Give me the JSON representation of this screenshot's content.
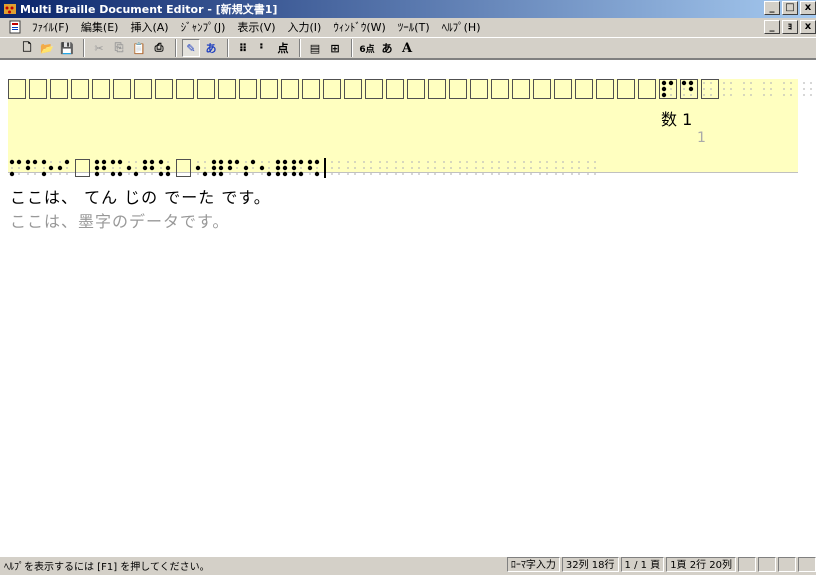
{
  "window": {
    "title": "Multi Braille Document Editor - [新規文書1]",
    "controls": [
      "_",
      "□",
      "x"
    ]
  },
  "menu": {
    "items": [
      "ﾌｧｲﾙ(F)",
      "編集(E)",
      "挿入(A)",
      "ｼﾞｬﾝﾌﾟ(J)",
      "表示(V)",
      "入力(I)",
      "ｳｨﾝﾄﾞｳ(W)",
      "ﾂｰﾙ(T)",
      "ﾍﾙﾌﾟ(H)"
    ],
    "mdi_controls": [
      "_",
      "ｮ",
      "x"
    ]
  },
  "toolbar": {
    "buttons": [
      {
        "name": "new-button",
        "icon": "new-document-icon",
        "glyph": "🗋"
      },
      {
        "name": "open-button",
        "icon": "open-folder-icon",
        "glyph": "📂"
      },
      {
        "name": "save-button",
        "icon": "save-icon",
        "glyph": "💾"
      },
      {
        "name": "cut-button",
        "icon": "cut-icon",
        "glyph": "✂"
      },
      {
        "name": "copy-button",
        "icon": "copy-icon",
        "glyph": "⎘"
      },
      {
        "name": "paste-button",
        "icon": "paste-icon",
        "glyph": "📋"
      },
      {
        "name": "print-button",
        "icon": "print-icon",
        "glyph": "⎙"
      },
      {
        "name": "braille-edit-button",
        "icon": "braille-edit-icon",
        "glyph": "✎"
      },
      {
        "name": "kana-edit-button",
        "icon": "kana-edit-icon",
        "glyph": "あ"
      },
      {
        "name": "braille-grid-button",
        "icon": "braille-grid-icon",
        "glyph": "⠿"
      },
      {
        "name": "braille-translate-button",
        "icon": "braille-translate-icon",
        "glyph": "⠃"
      },
      {
        "name": "kana-translate-button",
        "icon": "kana-translate-icon",
        "glyph": "点"
      },
      {
        "name": "layout-button",
        "icon": "layout-icon",
        "glyph": "▤"
      },
      {
        "name": "table-button",
        "icon": "table-icon",
        "glyph": "⊞"
      },
      {
        "name": "six-dot-button",
        "icon": "six-dot-icon",
        "glyph": "6点"
      },
      {
        "name": "hiragana-button",
        "icon": "hiragana-icon",
        "glyph": "あ"
      },
      {
        "name": "alphabet-button",
        "icon": "alphabet-icon",
        "glyph": "A"
      }
    ]
  },
  "document": {
    "number_label": "数 1",
    "number_value": "1",
    "text_line": "ここは、 てん じの でーた です。",
    "ink_line": "ここは、墨字のデータです。"
  },
  "status": {
    "help_text": "ﾍﾙﾌﾟを表示するには [F1] を押してください。",
    "input_mode": "ﾛｰﾏ字入力",
    "column_row": "32列 18行",
    "page_count": "1 / 1 頁",
    "position": "1頁 2行 20列"
  }
}
